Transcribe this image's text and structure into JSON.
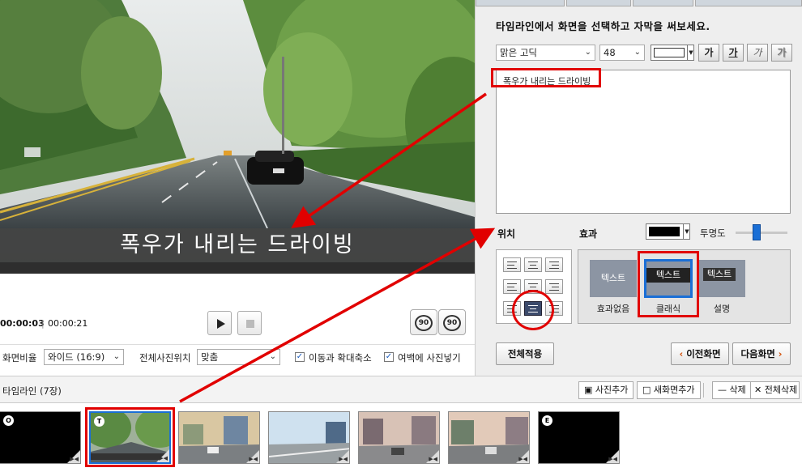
{
  "preview": {
    "caption": "폭우가 내리는 드라이빙"
  },
  "controls": {
    "current_time": "00:00:03",
    "separator": "|",
    "total_time": "00:00:21",
    "rotate_left_label": "90",
    "rotate_right_label": "90"
  },
  "settings": {
    "aspect_label": "화면비율",
    "aspect_value": "와이드 (16:9)",
    "photo_pos_label": "전체사진위치",
    "photo_pos_value": "맞춤",
    "move_zoom_label": "이동과 확대축소",
    "margin_photo_label": "여백에 사진넣기"
  },
  "panel": {
    "title": "타임라인에서 화면을 선택하고 자막을 써보세요.",
    "font_value": "맑은 고딕",
    "size_value": "48",
    "bold_label": "가",
    "underline_label": "가",
    "italic_label": "가",
    "shadow_label": "가",
    "text_value": "폭우가 내리는 드라이빙",
    "position_label": "위치",
    "effect_label": "효과",
    "opacity_label": "투명도",
    "effects": [
      {
        "tile": "텍스트",
        "label": "효과없음"
      },
      {
        "tile": "텍스트",
        "label": "클래식"
      },
      {
        "tile": "텍스트",
        "label": "설명"
      }
    ],
    "apply_all_label": "전체적용",
    "prev_label": "이전화면",
    "next_label": "다음화면",
    "font_color": "#ffffff",
    "effect_color": "#000000",
    "opacity_level": 0.4
  },
  "timeline": {
    "title": "타임라인 (7장)",
    "add_photo_label": "사진추가",
    "add_screen_label": "새화면추가",
    "delete_label": "삭제",
    "delete_all_label": "전체삭제",
    "items": [
      {
        "badge": "O"
      },
      {
        "badge": "T"
      },
      {
        "badge": ""
      },
      {
        "badge": ""
      },
      {
        "badge": ""
      },
      {
        "badge": ""
      },
      {
        "badge": "E"
      }
    ]
  },
  "colors": {
    "annotation_red": "#e10000",
    "selection_blue": "#1a6fd6",
    "tile_gray": "#8c95a3"
  }
}
